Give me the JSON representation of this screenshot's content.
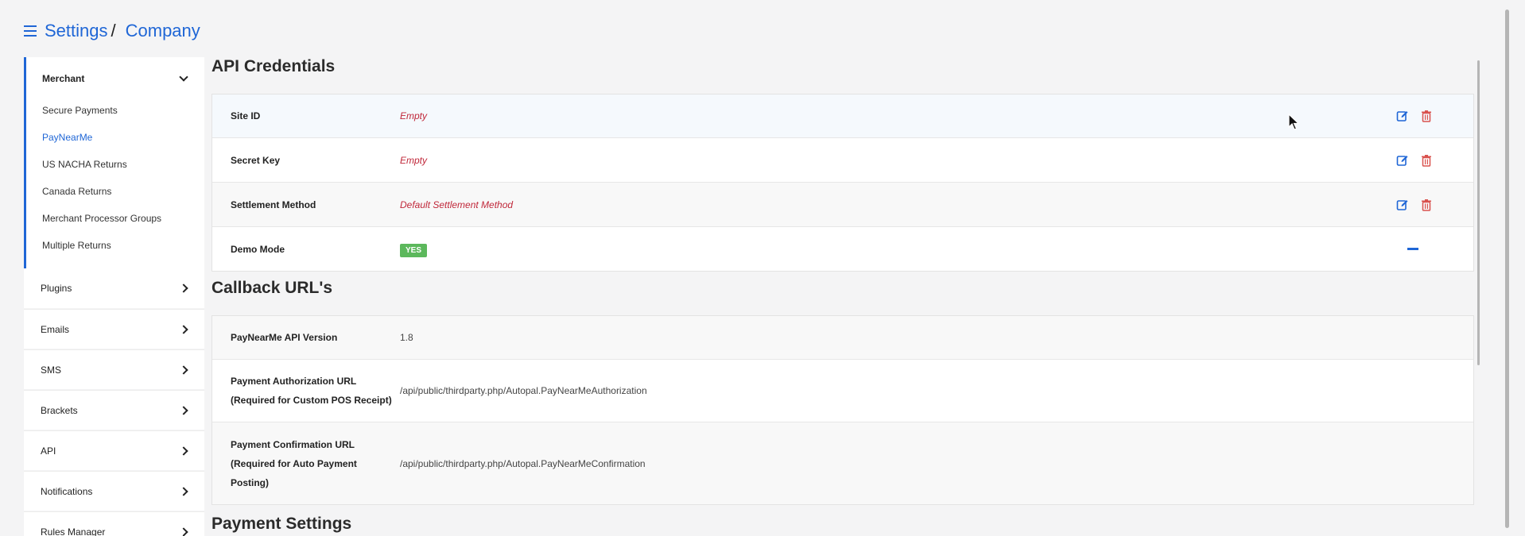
{
  "breadcrumb": {
    "settings": "Settings",
    "separator": "/",
    "company": "Company"
  },
  "sidebar": {
    "merchant": {
      "label": "Merchant",
      "items": [
        "Secure Payments",
        "PayNearMe",
        "US NACHA Returns",
        "Canada Returns",
        "Merchant Processor Groups",
        "Multiple Returns"
      ],
      "active": "PayNearMe"
    },
    "sections": [
      "Plugins",
      "Emails",
      "SMS",
      "Brackets",
      "API",
      "Notifications",
      "Rules Manager"
    ]
  },
  "api_credentials": {
    "title": "API Credentials",
    "rows": [
      {
        "label": "Site ID",
        "value": "Empty"
      },
      {
        "label": "Secret Key",
        "value": "Empty"
      },
      {
        "label": "Settlement Method",
        "value": "Default Settlement Method"
      },
      {
        "label": "Demo Mode",
        "value": "YES"
      }
    ]
  },
  "callback_urls": {
    "title": "Callback URL's",
    "rows": [
      {
        "label": "PayNearMe API Version",
        "value": "1.8"
      },
      {
        "label_line1": "Payment Authorization URL",
        "label_line2": "(Required for Custom POS Receipt)",
        "value": "/api/public/thirdparty.php/Autopal.PayNearMeAuthorization"
      },
      {
        "label_line1": "Payment Confirmation URL",
        "label_line2": "(Required for Auto Payment",
        "label_line3": "Posting)",
        "value": "/api/public/thirdparty.php/Autopal.PayNearMeConfirmation"
      }
    ]
  },
  "payment_settings": {
    "title": "Payment Settings"
  },
  "colors": {
    "accent": "#1f66d6",
    "empty_text": "#c0283a",
    "delete": "#d9534f",
    "badge": "#5cb85c"
  }
}
